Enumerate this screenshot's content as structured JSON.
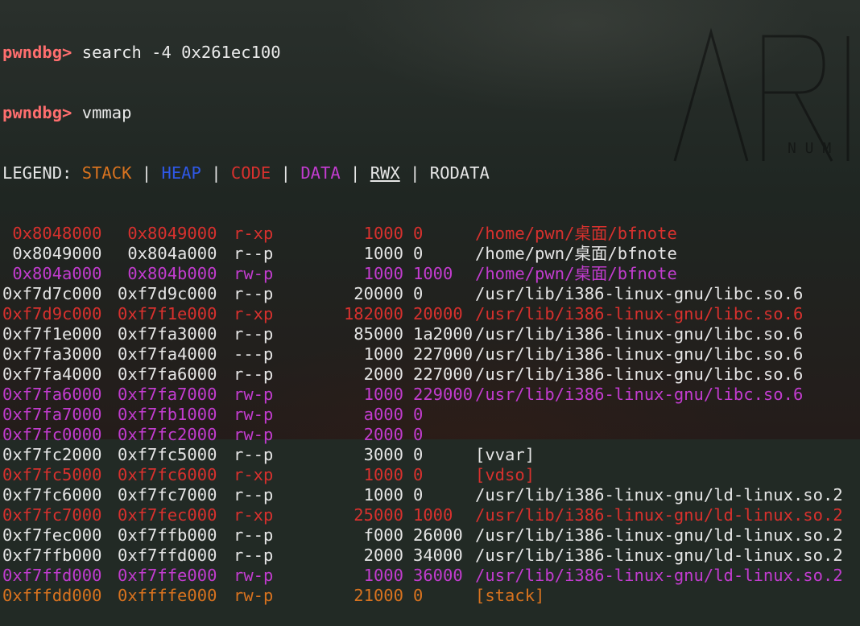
{
  "prompt": "pwndbg>",
  "commands": [
    "search -4 0x261ec100",
    "vmmap"
  ],
  "legend": {
    "label": "LEGEND:",
    "items": [
      {
        "text": "STACK",
        "kind": "stack"
      },
      {
        "text": "HEAP",
        "kind": "heap"
      },
      {
        "text": "CODE",
        "kind": "code"
      },
      {
        "text": "DATA",
        "kind": "data"
      },
      {
        "text": "RWX",
        "kind": "rwx"
      },
      {
        "text": "RODATA",
        "kind": "ro"
      }
    ],
    "separator": "|"
  },
  "watermark_text": "ARI",
  "watermark_sub": "N U M",
  "colors": {
    "prompt": "#ff6e6e",
    "stack": "#d9731f",
    "heap": "#2f58e6",
    "code": "#d8312e",
    "data": "#c23ccf",
    "ro": "#e6e6e6"
  },
  "rows": [
    {
      "start": " 0x8048000",
      "end": " 0x8049000",
      "perm": "r-xp",
      "size": "1000",
      "offset": "0",
      "file": "/home/pwn/桌面/bfnote",
      "kind": "code"
    },
    {
      "start": " 0x8049000",
      "end": " 0x804a000",
      "perm": "r--p",
      "size": "1000",
      "offset": "0",
      "file": "/home/pwn/桌面/bfnote",
      "kind": "ro"
    },
    {
      "start": " 0x804a000",
      "end": " 0x804b000",
      "perm": "rw-p",
      "size": "1000",
      "offset": "1000",
      "file": "/home/pwn/桌面/bfnote",
      "kind": "data"
    },
    {
      "start": "0xf7d7c000",
      "end": "0xf7d9c000",
      "perm": "r--p",
      "size": "20000",
      "offset": "0",
      "file": "/usr/lib/i386-linux-gnu/libc.so.6",
      "kind": "ro"
    },
    {
      "start": "0xf7d9c000",
      "end": "0xf7f1e000",
      "perm": "r-xp",
      "size": "182000",
      "offset": "20000",
      "file": "/usr/lib/i386-linux-gnu/libc.so.6",
      "kind": "code"
    },
    {
      "start": "0xf7f1e000",
      "end": "0xf7fa3000",
      "perm": "r--p",
      "size": "85000",
      "offset": "1a2000",
      "file": "/usr/lib/i386-linux-gnu/libc.so.6",
      "kind": "ro"
    },
    {
      "start": "0xf7fa3000",
      "end": "0xf7fa4000",
      "perm": "---p",
      "size": "1000",
      "offset": "227000",
      "file": "/usr/lib/i386-linux-gnu/libc.so.6",
      "kind": "ro"
    },
    {
      "start": "0xf7fa4000",
      "end": "0xf7fa6000",
      "perm": "r--p",
      "size": "2000",
      "offset": "227000",
      "file": "/usr/lib/i386-linux-gnu/libc.so.6",
      "kind": "ro"
    },
    {
      "start": "0xf7fa6000",
      "end": "0xf7fa7000",
      "perm": "rw-p",
      "size": "1000",
      "offset": "229000",
      "file": "/usr/lib/i386-linux-gnu/libc.so.6",
      "kind": "data"
    },
    {
      "start": "0xf7fa7000",
      "end": "0xf7fb1000",
      "perm": "rw-p",
      "size": "a000",
      "offset": "0",
      "file": "",
      "kind": "data"
    },
    {
      "start": "0xf7fc0000",
      "end": "0xf7fc2000",
      "perm": "rw-p",
      "size": "2000",
      "offset": "0",
      "file": "",
      "kind": "data"
    },
    {
      "start": "0xf7fc2000",
      "end": "0xf7fc5000",
      "perm": "r--p",
      "size": "3000",
      "offset": "0",
      "file": "[vvar]",
      "kind": "ro"
    },
    {
      "start": "0xf7fc5000",
      "end": "0xf7fc6000",
      "perm": "r-xp",
      "size": "1000",
      "offset": "0",
      "file": "[vdso]",
      "kind": "code"
    },
    {
      "start": "0xf7fc6000",
      "end": "0xf7fc7000",
      "perm": "r--p",
      "size": "1000",
      "offset": "0",
      "file": "/usr/lib/i386-linux-gnu/ld-linux.so.2",
      "kind": "ro"
    },
    {
      "start": "0xf7fc7000",
      "end": "0xf7fec000",
      "perm": "r-xp",
      "size": "25000",
      "offset": "1000",
      "file": "/usr/lib/i386-linux-gnu/ld-linux.so.2",
      "kind": "code"
    },
    {
      "start": "0xf7fec000",
      "end": "0xf7ffb000",
      "perm": "r--p",
      "size": "f000",
      "offset": "26000",
      "file": "/usr/lib/i386-linux-gnu/ld-linux.so.2",
      "kind": "ro"
    },
    {
      "start": "0xf7ffb000",
      "end": "0xf7ffd000",
      "perm": "r--p",
      "size": "2000",
      "offset": "34000",
      "file": "/usr/lib/i386-linux-gnu/ld-linux.so.2",
      "kind": "ro"
    },
    {
      "start": "0xf7ffd000",
      "end": "0xf7ffe000",
      "perm": "rw-p",
      "size": "1000",
      "offset": "36000",
      "file": "/usr/lib/i386-linux-gnu/ld-linux.so.2",
      "kind": "data"
    },
    {
      "start": "0xfffdd000",
      "end": "0xffffe000",
      "perm": "rw-p",
      "size": "21000",
      "offset": "0",
      "file": "[stack]",
      "kind": "stack"
    }
  ]
}
